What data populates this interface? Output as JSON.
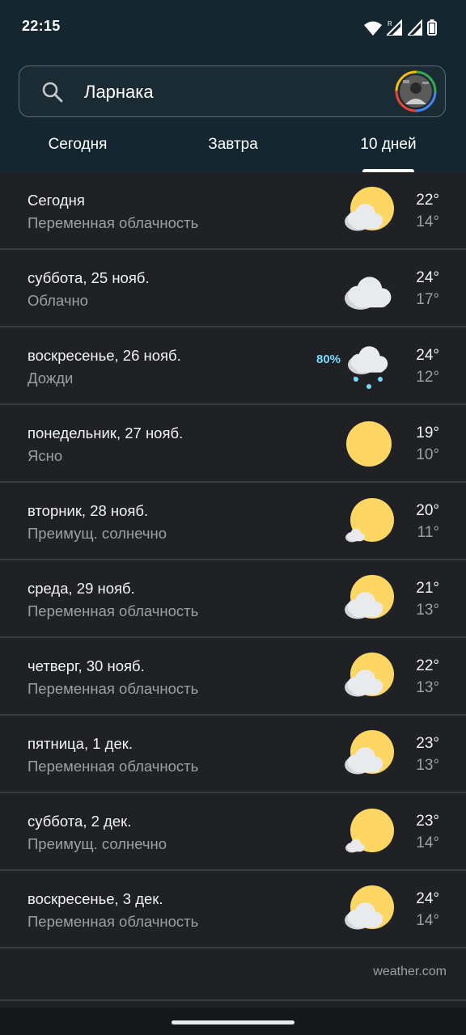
{
  "status_bar": {
    "time": "22:15",
    "icons": [
      "wifi-icon",
      "signal-roaming-icon",
      "signal-icon",
      "battery-icon"
    ]
  },
  "search": {
    "value": "Ларнака",
    "icon": "search-icon"
  },
  "tabs": [
    {
      "label": "Сегодня",
      "selected": false
    },
    {
      "label": "Завтра",
      "selected": false
    },
    {
      "label": "10 дней",
      "selected": true
    }
  ],
  "forecast": [
    {
      "day": "Сегодня",
      "condition": "Переменная облачность",
      "high": "22°",
      "low": "14°",
      "icon": "partly-cloudy-icon",
      "precip": ""
    },
    {
      "day": "суббота, 25 нояб.",
      "condition": "Облачно",
      "high": "24°",
      "low": "17°",
      "icon": "cloudy-icon",
      "precip": ""
    },
    {
      "day": "воскресенье, 26 нояб.",
      "condition": "Дожди",
      "high": "24°",
      "low": "12°",
      "icon": "rain-icon",
      "precip": "80%"
    },
    {
      "day": "понедельник, 27 нояб.",
      "condition": "Ясно",
      "high": "19°",
      "low": "10°",
      "icon": "sunny-icon",
      "precip": ""
    },
    {
      "day": "вторник, 28 нояб.",
      "condition": "Преимущ. солнечно",
      "high": "20°",
      "low": "11°",
      "icon": "mostly-sunny-icon",
      "precip": ""
    },
    {
      "day": "среда, 29 нояб.",
      "condition": "Переменная облачность",
      "high": "21°",
      "low": "13°",
      "icon": "partly-cloudy-icon",
      "precip": ""
    },
    {
      "day": "четверг, 30 нояб.",
      "condition": "Переменная облачность",
      "high": "22°",
      "low": "13°",
      "icon": "partly-cloudy-icon",
      "precip": ""
    },
    {
      "day": "пятница, 1 дек.",
      "condition": "Переменная облачность",
      "high": "23°",
      "low": "13°",
      "icon": "partly-cloudy-icon",
      "precip": ""
    },
    {
      "day": "суббота, 2 дек.",
      "condition": "Преимущ. солнечно",
      "high": "23°",
      "low": "14°",
      "icon": "mostly-sunny-icon",
      "precip": ""
    },
    {
      "day": "воскресенье, 3 дек.",
      "condition": "Переменная облачность",
      "high": "24°",
      "low": "14°",
      "icon": "partly-cloudy-icon",
      "precip": ""
    }
  ],
  "source": "weather.com",
  "colors": {
    "header_bg": "#142731",
    "page_bg": "#202124",
    "sun": "#fdd663",
    "cloud": "#e8eaed",
    "precip": "#78d9ff"
  }
}
